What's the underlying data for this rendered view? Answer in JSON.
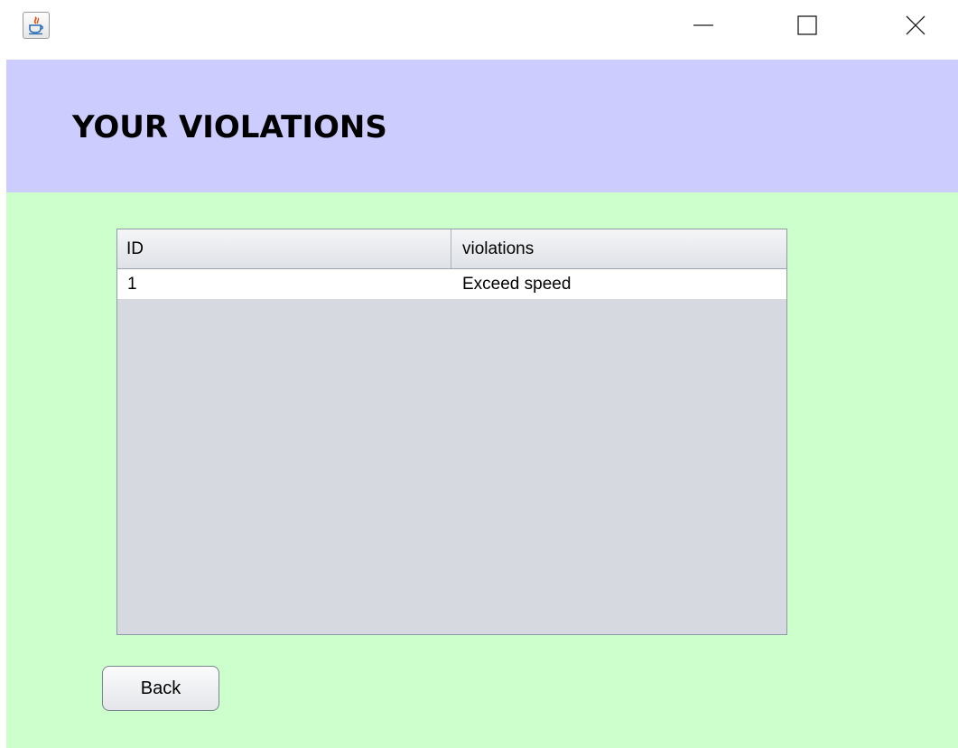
{
  "window": {
    "app_icon": "java-cup-icon",
    "controls": {
      "minimize_icon": "minimize-icon",
      "maximize_icon": "maximize-icon",
      "close_icon": "close-icon"
    }
  },
  "header": {
    "title": "YOUR VIOLATIONS"
  },
  "table": {
    "columns": [
      "ID",
      "violations"
    ],
    "rows": [
      [
        "1",
        "Exceed speed"
      ]
    ]
  },
  "actions": {
    "back_label": "Back"
  },
  "colors": {
    "header_bg": "#ccccff",
    "content_bg": "#ccffcc",
    "table_empty_bg": "#d6d9df"
  }
}
